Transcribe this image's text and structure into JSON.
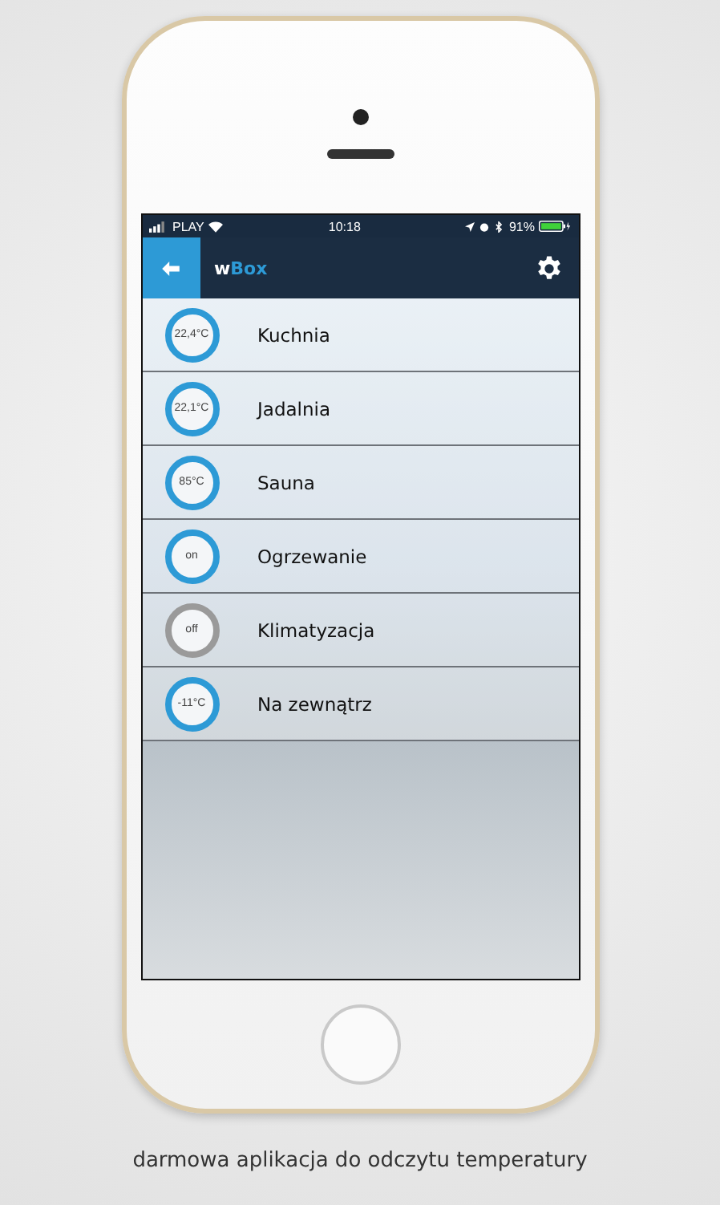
{
  "status_bar": {
    "carrier": "PLAY",
    "time": "10:18",
    "battery": "91%"
  },
  "app_bar": {
    "title_parts": [
      {
        "text": "w",
        "accent": false
      },
      {
        "text": "Box",
        "accent": true
      }
    ]
  },
  "sensors": [
    {
      "reading": "22,4°C",
      "name": "Kuchnia",
      "active": true
    },
    {
      "reading": "22,1°C",
      "name": "Jadalnia",
      "active": true
    },
    {
      "reading": "85°C",
      "name": "Sauna",
      "active": true
    },
    {
      "reading": "on",
      "name": "Ogrzewanie",
      "active": true
    },
    {
      "reading": "off",
      "name": "Klimatyzacja",
      "active": false
    },
    {
      "reading": "-11°C",
      "name": "Na zewnątrz",
      "active": true
    }
  ],
  "caption": "darmowa aplikacja do odczytu temperatury"
}
